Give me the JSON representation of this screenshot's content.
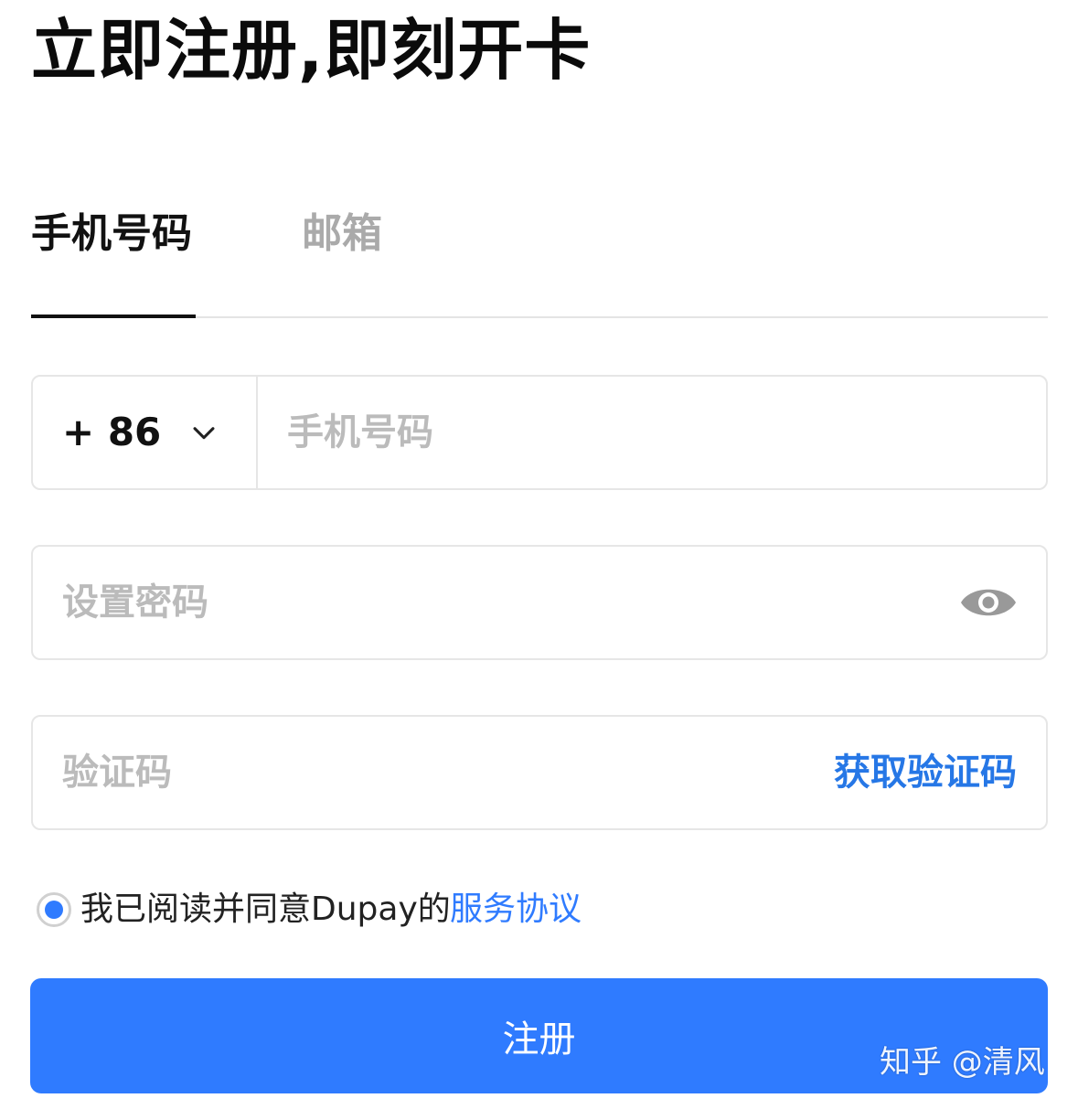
{
  "page": {
    "title": "立即注册,即刻开卡"
  },
  "tabs": {
    "items": [
      {
        "label": "手机号码",
        "active": true
      },
      {
        "label": "邮箱",
        "active": false
      }
    ]
  },
  "form": {
    "phone": {
      "country_code": "+ 86",
      "placeholder": "手机号码",
      "value": ""
    },
    "password": {
      "placeholder": "设置密码",
      "value": "",
      "toggle_icon": "eye-icon"
    },
    "verification": {
      "placeholder": "验证码",
      "value": "",
      "get_code_label": "获取验证码"
    },
    "agreement": {
      "checked": true,
      "text": "我已阅读并同意Dupay的",
      "link_label": "服务协议"
    },
    "submit_label": "注册"
  },
  "watermark": {
    "text": "知乎 @清风"
  },
  "colors": {
    "accent": "#2f7bff",
    "link": "#2677e6",
    "placeholder": "#bbbbbb",
    "border": "#e6e6e6"
  }
}
